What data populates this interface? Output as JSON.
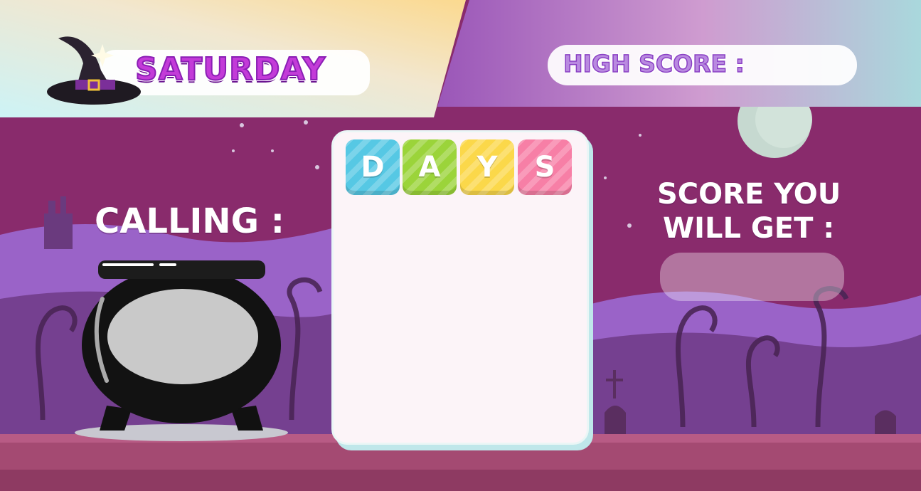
{
  "header": {
    "day_title": "SATURDAY",
    "high_score_label": "HIGH SCORE :",
    "high_score_value": ""
  },
  "left_panel": {
    "calling_label": "CALLING :",
    "calling_value": ""
  },
  "board": {
    "tiles": [
      {
        "letter": "D",
        "color": "#56c8e4"
      },
      {
        "letter": "A",
        "color": "#9bd43a"
      },
      {
        "letter": "Y",
        "color": "#fbd84a"
      },
      {
        "letter": "S",
        "color": "#f77fa6"
      }
    ]
  },
  "right_panel": {
    "score_label_line1": "SCORE YOU",
    "score_label_line2": "WILL GET :",
    "score_value": ""
  },
  "colors": {
    "sky_purple": "#8a2a6a",
    "hill_violet": "#9a63c8",
    "ground_rose": "#a44a72",
    "title_purple": "#c33bd8"
  },
  "icons": [
    "witch-hat-icon",
    "cauldron-icon",
    "moon-icon",
    "castle-icon"
  ]
}
